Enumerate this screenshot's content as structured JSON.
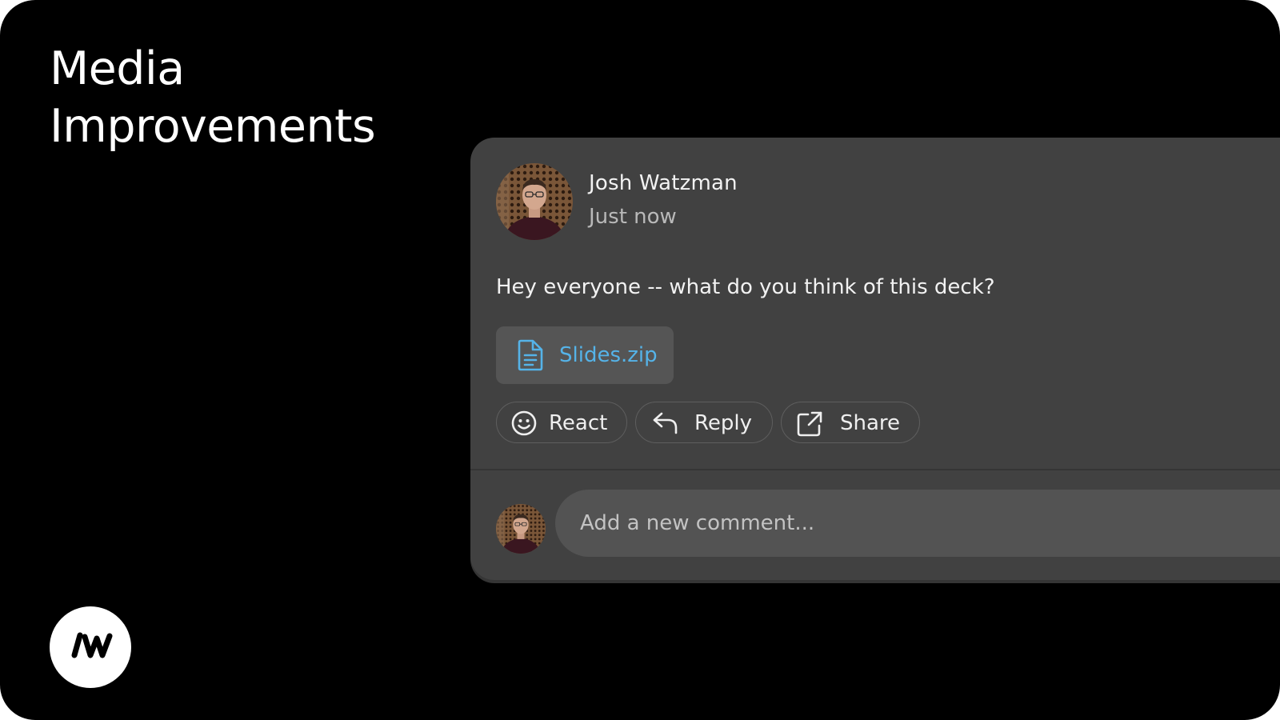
{
  "slide": {
    "title_line1": "Media",
    "title_line2": "Improvements",
    "logo_text": "/W"
  },
  "post": {
    "author": "Josh Watzman",
    "timestamp": "Just now",
    "message": "Hey everyone -- what do you think of this deck?",
    "attachment": {
      "name": "Slides.zip",
      "icon": "document-icon"
    },
    "actions": [
      {
        "label": "React",
        "icon": "smiley-icon"
      },
      {
        "label": "Reply",
        "icon": "reply-arrow-icon"
      },
      {
        "label": "Share",
        "icon": "external-share-icon"
      }
    ]
  },
  "comment": {
    "placeholder": "Add a new comment..."
  },
  "colors": {
    "background": "#000000",
    "card": "#414141",
    "attachment_bg": "#555555",
    "link": "#55b3e8",
    "input_bg": "#535353"
  }
}
